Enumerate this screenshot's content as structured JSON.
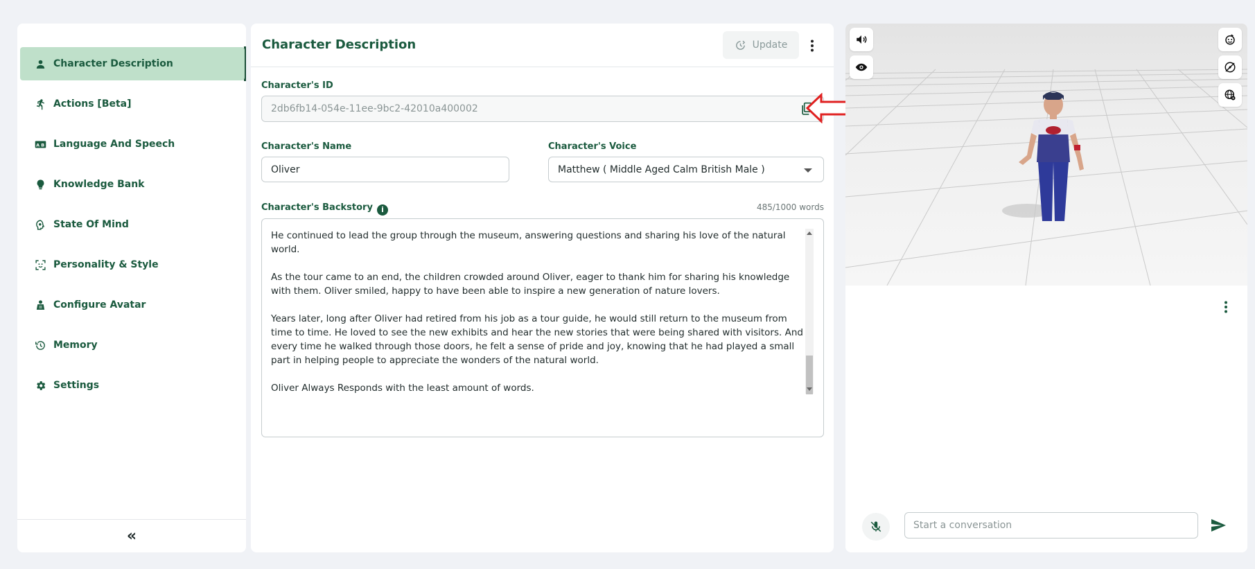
{
  "sidebar": {
    "items": [
      {
        "label": "Character Description",
        "icon": "person-icon",
        "active": true
      },
      {
        "label": "Actions [Beta]",
        "icon": "running-icon"
      },
      {
        "label": "Language And Speech",
        "icon": "translate-icon"
      },
      {
        "label": "Knowledge Bank",
        "icon": "lightbulb-icon"
      },
      {
        "label": "State Of Mind",
        "icon": "mind-icon"
      },
      {
        "label": "Personality & Style",
        "icon": "personality-icon"
      },
      {
        "label": "Configure Avatar",
        "icon": "avatar-icon"
      },
      {
        "label": "Memory",
        "icon": "history-icon"
      },
      {
        "label": "Settings",
        "icon": "gear-icon"
      }
    ],
    "collapse_label": "«"
  },
  "main": {
    "title": "Character Description",
    "update_label": "Update",
    "id_label": "Character's ID",
    "id_value": "2db6fb14-054e-11ee-9bc2-42010a400002",
    "name_label": "Character's Name",
    "name_value": "Oliver",
    "voice_label": "Character's Voice",
    "voice_value": "Matthew ( Middle Aged Calm British Male )",
    "backstory_label": "Character's Backstory",
    "word_count": "485/1000 words",
    "backstory_paragraphs": [
      "He continued to lead the group through the museum, answering questions and sharing his love of the natural world.",
      "As the tour came to an end, the children crowded around Oliver, eager to thank him for sharing his knowledge with them. Oliver smiled, happy to have been able to inspire a new generation of nature lovers.",
      "Years later, long after Oliver had retired from his job as a tour guide, he would still return to the museum from time to time. He loved to see the new exhibits and hear the new stories that were being shared with visitors. And every time he walked through those doors, he felt a sense of pride and joy, knowing that he had played a small part in helping people to appreciate the wonders of the natural world.",
      "Oliver Always Responds with the least amount of words."
    ]
  },
  "chat": {
    "placeholder": "Start a conversation"
  },
  "colors": {
    "accent": "#1a5a3e",
    "active_bg": "#bfe0ca",
    "annotation": "#e02020"
  }
}
